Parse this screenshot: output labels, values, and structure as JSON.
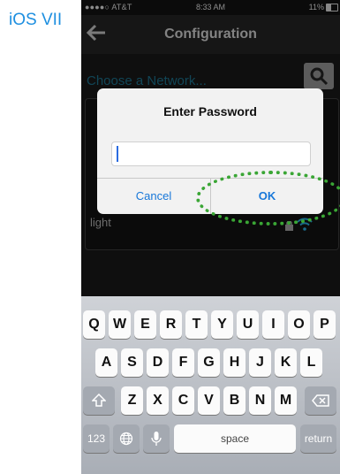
{
  "caption": "iOS VII",
  "status_bar": {
    "carrier": "●●●●○ AT&T",
    "time": "8:33 AM",
    "battery": "11%"
  },
  "nav": {
    "title": "Configuration",
    "back_icon": "back-arrow-icon"
  },
  "network": {
    "label": "Choose a Network...",
    "search_icon": "search-icon",
    "items": [
      "light"
    ]
  },
  "alert": {
    "title": "Enter Password",
    "input_value": "",
    "cancel_label": "Cancel",
    "ok_label": "OK"
  },
  "keyboard": {
    "row1": [
      "Q",
      "W",
      "E",
      "R",
      "T",
      "Y",
      "U",
      "I",
      "O",
      "P"
    ],
    "row2": [
      "A",
      "S",
      "D",
      "F",
      "G",
      "H",
      "J",
      "K",
      "L"
    ],
    "row3": [
      "Z",
      "X",
      "C",
      "V",
      "B",
      "N",
      "M"
    ],
    "numbers_label": "123",
    "space_label": "space",
    "return_label": "return"
  },
  "colors": {
    "caption": "#1e8fe0",
    "highlight": "#3aa635",
    "link": "#1777d9"
  }
}
